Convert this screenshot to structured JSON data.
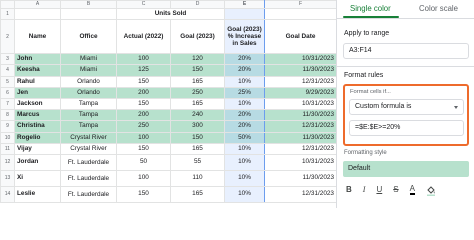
{
  "sheet": {
    "columns": [
      "A",
      "B",
      "C",
      "D",
      "E",
      "F"
    ],
    "selected_column": "E",
    "row1_label": "Units Sold",
    "headers": {
      "name": "Name",
      "office": "Office",
      "actual": "Actual (2022)",
      "goal": "Goal (2023)",
      "increase": "Goal (2023) % Increase in Sales",
      "goal_date": "Goal Date"
    },
    "header_row_numbers": [
      "1",
      "2"
    ],
    "rows": [
      {
        "num": "3",
        "name": "John",
        "office": "Miami",
        "actual": "100",
        "goal": "120",
        "increase": "20%",
        "date": "10/31/2023",
        "highlighted": true
      },
      {
        "num": "4",
        "name": "Keesha",
        "office": "Miami",
        "actual": "125",
        "goal": "150",
        "increase": "20%",
        "date": "11/30/2023",
        "highlighted": true
      },
      {
        "num": "5",
        "name": "Rahul",
        "office": "Orlando",
        "actual": "150",
        "goal": "165",
        "increase": "10%",
        "date": "12/31/2023",
        "highlighted": false
      },
      {
        "num": "6",
        "name": "Jen",
        "office": "Orlando",
        "actual": "200",
        "goal": "250",
        "increase": "25%",
        "date": "9/29/2023",
        "highlighted": true
      },
      {
        "num": "7",
        "name": "Jackson",
        "office": "Tampa",
        "actual": "150",
        "goal": "165",
        "increase": "10%",
        "date": "10/31/2023",
        "highlighted": false
      },
      {
        "num": "8",
        "name": "Marcus",
        "office": "Tampa",
        "actual": "200",
        "goal": "240",
        "increase": "20%",
        "date": "11/30/2023",
        "highlighted": true
      },
      {
        "num": "9",
        "name": "Christina",
        "office": "Tampa",
        "actual": "250",
        "goal": "300",
        "increase": "20%",
        "date": "12/31/2023",
        "highlighted": true
      },
      {
        "num": "10",
        "name": "Rogelio",
        "office": "Crystal River",
        "actual": "100",
        "goal": "150",
        "increase": "50%",
        "date": "11/30/2023",
        "highlighted": true
      },
      {
        "num": "11",
        "name": "Vijay",
        "office": "Crystal River",
        "actual": "150",
        "goal": "165",
        "increase": "10%",
        "date": "12/31/2023",
        "highlighted": false
      },
      {
        "num": "12",
        "name": "Jordan",
        "office": "Ft. Lauderdale",
        "actual": "50",
        "goal": "55",
        "increase": "10%",
        "date": "10/31/2023",
        "highlighted": false,
        "tall": true
      },
      {
        "num": "13",
        "name": "Xi",
        "office": "Ft. Lauderdale",
        "actual": "100",
        "goal": "110",
        "increase": "10%",
        "date": "11/30/2023",
        "highlighted": false,
        "tall": true
      },
      {
        "num": "14",
        "name": "Leslie",
        "office": "Ft. Lauderdale",
        "actual": "150",
        "goal": "165",
        "increase": "10%",
        "date": "12/31/2023",
        "highlighted": false,
        "tall": true
      }
    ]
  },
  "panel": {
    "tabs": [
      {
        "label": "Single color",
        "active": true
      },
      {
        "label": "Color scale",
        "active": false
      }
    ],
    "apply_range_label": "Apply to range",
    "apply_range_value": "A3:F14",
    "format_rules_label": "Format rules",
    "format_cells_if_label": "Format cells if...",
    "condition_value": "Custom formula is",
    "formula_value": "=$E:$E>=20%",
    "formatting_style_label": "Formatting style",
    "style_preview_label": "Default",
    "highlight_color": "#b7e1cd",
    "accent_color": "#188038",
    "callout_color": "#ee6b2c",
    "format_buttons": [
      {
        "label": "B",
        "name": "bold-button"
      },
      {
        "label": "I",
        "name": "italic-button"
      },
      {
        "label": "U",
        "name": "underline-button"
      },
      {
        "label": "S",
        "name": "strikethrough-button"
      },
      {
        "label": "A",
        "name": "text-color-button"
      }
    ],
    "fill_icon": "paint-bucket-icon"
  }
}
